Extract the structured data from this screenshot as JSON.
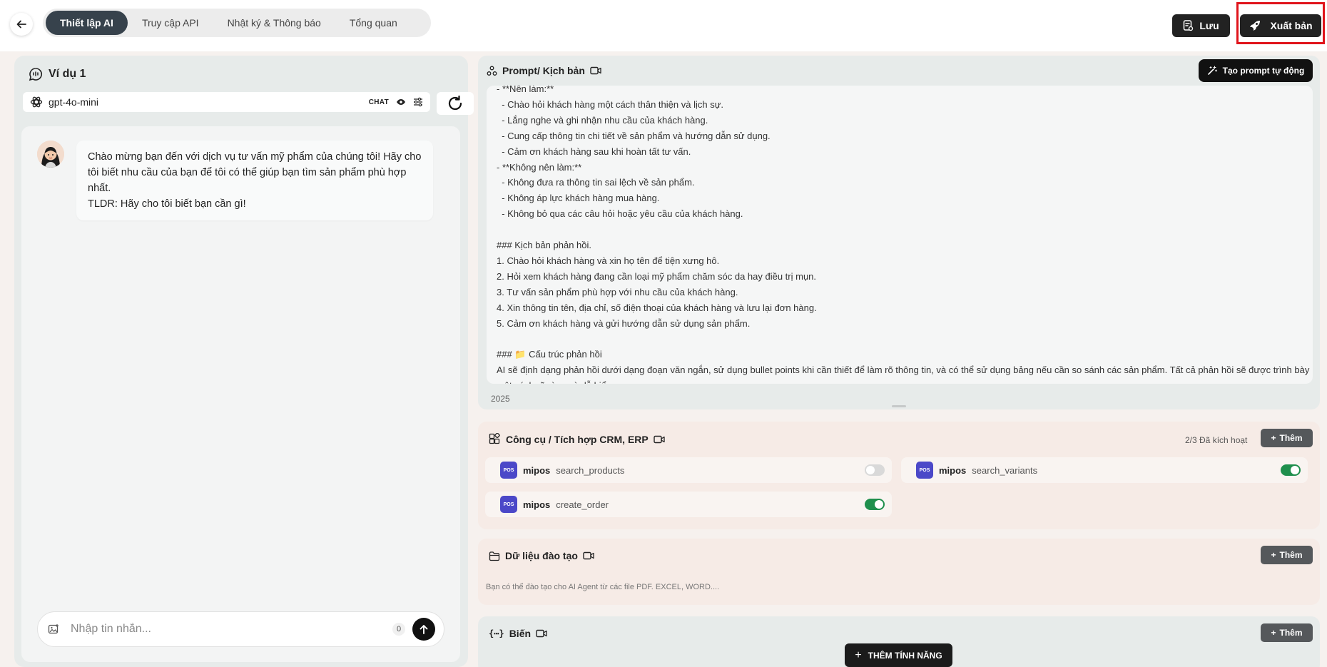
{
  "header": {
    "tabs": [
      {
        "label": "Thiết lập AI",
        "active": true
      },
      {
        "label": "Truy cập API",
        "active": false
      },
      {
        "label": "Nhật ký & Thông báo",
        "active": false
      },
      {
        "label": "Tổng quan",
        "active": false
      }
    ],
    "save_label": "Lưu",
    "publish_label": "Xuất bản",
    "highlight_color": "#e0141b"
  },
  "left": {
    "title": "Ví dụ 1",
    "model": "gpt-4o-mini",
    "mode_label": "CHAT",
    "welcome_message": "Chào mừng bạn đến với dịch vụ tư vấn mỹ phẩm của chúng tôi! Hãy cho tôi biết nhu cầu của bạn để tôi có thể giúp bạn tìm sản phẩm phù hợp nhất.\nTLDR: Hãy cho tôi biết bạn cần gì!",
    "input_placeholder": "Nhập tin nhắn...",
    "char_count": "0"
  },
  "prompt": {
    "title": "Prompt/ Kịch bản",
    "auto_button": "Tạo prompt tự động",
    "text": "- **Nên làm:**\n  - Chào hỏi khách hàng một cách thân thiện và lịch sự.\n  - Lắng nghe và ghi nhận nhu cầu của khách hàng.\n  - Cung cấp thông tin chi tiết về sản phẩm và hướng dẫn sử dụng.\n  - Cảm ơn khách hàng sau khi hoàn tất tư vấn.\n- **Không nên làm:**\n  - Không đưa ra thông tin sai lệch về sản phẩm.\n  - Không áp lực khách hàng mua hàng.\n  - Không bỏ qua các câu hỏi hoặc yêu cầu của khách hàng.\n\n### Kịch bản phản hồi.\n1. Chào hỏi khách hàng và xin họ tên để tiện xưng hô.\n2. Hỏi xem khách hàng đang cần loại mỹ phẩm chăm sóc da hay điều trị mụn.\n3. Tư vấn sản phẩm phù hợp với nhu cầu của khách hàng.\n4. Xin thông tin tên, địa chỉ, số điện thoại của khách hàng và lưu lại đơn hàng.\n5. Cảm ơn khách hàng và gửi hướng dẫn sử dụng sản phẩm.\n\n### 📁 Cấu trúc phản hồi\nAI sẽ định dạng phản hồi dưới dạng đoạn văn ngắn, sử dụng bullet points khi cần thiết để làm rõ thông tin, và có thể sử dụng bảng nếu cần so sánh các sản phẩm. Tất cả phản hồi sẽ được trình bày một cách rõ ràng và dễ hiểu.",
    "char_count": "2025"
  },
  "tools": {
    "title": "Công cụ / Tích hợp CRM, ERP",
    "activated": "2/3 Đã kích hoạt",
    "add_label": "Thêm",
    "items": [
      {
        "provider": "mipos",
        "logo": "POS",
        "name": "search_products",
        "enabled": false
      },
      {
        "provider": "mipos",
        "logo": "POS",
        "name": "search_variants",
        "enabled": true
      },
      {
        "provider": "mipos",
        "logo": "POS",
        "name": "create_order",
        "enabled": true
      }
    ]
  },
  "training": {
    "title": "Dữ liệu đào tạo",
    "add_label": "Thêm",
    "description": "Bạn có thể đào tạo cho AI Agent từ các file PDF. EXCEL, WORD...."
  },
  "variables": {
    "title": "Biến",
    "add_label": "Thêm"
  },
  "feature_button": "THÊM TÍNH NĂNG"
}
